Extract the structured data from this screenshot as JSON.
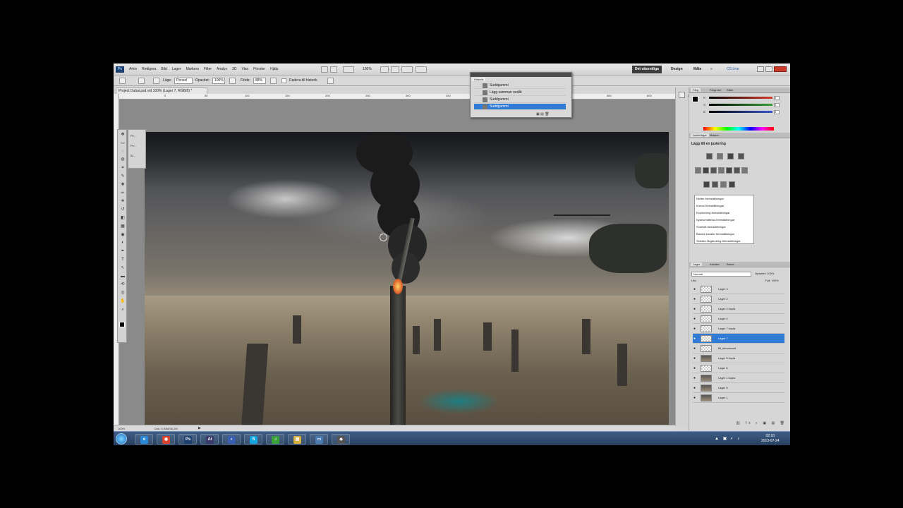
{
  "app": {
    "logo": "Ps",
    "menu": [
      "Arkiv",
      "Redigera",
      "Bild",
      "Lager",
      "Markera",
      "Filter",
      "Analys",
      "3D",
      "Visa",
      "Fönster",
      "Hjälp"
    ],
    "zoom": "100%",
    "workspaces": {
      "essentials": "Det väsentliga",
      "design": "Design",
      "more": "Måla",
      "chevron": "»",
      "cslive": "CS Live"
    }
  },
  "options_bar": {
    "mode_label": "Läge:",
    "mode_value": "Pensel",
    "opacity_label": "Opacitet:",
    "opacity_value": "100%",
    "flow_label": "Flöde:",
    "flow_value": "88%",
    "erase_label": "Radera till historik"
  },
  "document": {
    "tab_title": "Project Dubai.psd vid 100% (Lager 7, RGB/8) *",
    "ruler_numbers": [
      "0",
      "50",
      "100",
      "150",
      "200",
      "250",
      "300",
      "350",
      "400",
      "450",
      "500",
      "550",
      "600",
      "650",
      "700"
    ],
    "status_zoom": "100%",
    "status_doc": "Dok: 5,93M/36,2M"
  },
  "history": {
    "tab": "Historik",
    "rows": [
      {
        "label": "Suddgummi",
        "selected": false
      },
      {
        "label": "Lägg samman nedåt",
        "selected": false
      },
      {
        "label": "Suddgummi",
        "selected": false
      },
      {
        "label": "Suddgummi",
        "selected": true
      }
    ]
  },
  "tool_presets": [
    "Pe...",
    "Pe...",
    "Bi..."
  ],
  "color_panel": {
    "tabs": [
      "Färg",
      "Färgrutor",
      "Stilar"
    ],
    "sliders": [
      {
        "label": "R",
        "value": "0",
        "color": "#d43a2a"
      },
      {
        "label": "G",
        "value": "0",
        "color": "#3aa03a"
      },
      {
        "label": "B",
        "value": "0",
        "color": "#3a55c8"
      }
    ]
  },
  "adjustments": {
    "tabs": [
      "Justeringar",
      "Masker"
    ],
    "title": "Lägg till en justering",
    "presets": [
      "Nivåer-förinställningar",
      "Kurvor-förinställningar",
      "Exponering-förinställningar",
      "Nyans/mättnad-förinställningar",
      "Svartvitt-förinställningar",
      "Blanda kanaler-förinställningar",
      "Selektiv färgändring-förinställningar"
    ]
  },
  "layers": {
    "tabs": [
      "Lager",
      "Kanaler",
      "Banor"
    ],
    "mode": "Normal",
    "opacity_label": "Opacitet: 100%",
    "lock_label": "Lås:",
    "fill_label": "Fyll: 100%",
    "rows": [
      {
        "name": "Lager 3",
        "selected": false,
        "thumb": "empty"
      },
      {
        "name": "Lager 2",
        "selected": false,
        "thumb": "empty"
      },
      {
        "name": "Lager 4 kopia",
        "selected": false,
        "thumb": "empty"
      },
      {
        "name": "Lager 4",
        "selected": false,
        "thumb": "empty"
      },
      {
        "name": "Lager 7 kopia",
        "selected": false,
        "thumb": "empty"
      },
      {
        "name": "Lager 7",
        "selected": true,
        "thumb": "empty"
      },
      {
        "name": "fill_shuvesmid",
        "selected": false,
        "thumb": "empty"
      },
      {
        "name": "Lager 5 kopia",
        "selected": false,
        "thumb": "img"
      },
      {
        "name": "Lager 6",
        "selected": false,
        "thumb": "empty"
      },
      {
        "name": "Lager 1 kopia",
        "selected": false,
        "thumb": "img"
      },
      {
        "name": "Lager 5",
        "selected": false,
        "thumb": "img"
      },
      {
        "name": "Lager 1",
        "selected": false,
        "thumb": "img"
      }
    ]
  },
  "taskbar": {
    "apps": [
      {
        "name": "ie-icon",
        "glyph": "e",
        "color": "#2a8ad8"
      },
      {
        "name": "chrome-icon",
        "glyph": "◉",
        "color": "#d8462f"
      },
      {
        "name": "photoshop-icon",
        "glyph": "Ps",
        "color": "#1c3f6e"
      },
      {
        "name": "aftereffects-icon",
        "glyph": "Ai",
        "color": "#3a3a6a"
      },
      {
        "name": "firefox-icon",
        "glyph": "◐",
        "color": "#3a5fb0"
      },
      {
        "name": "skype-icon",
        "glyph": "S",
        "color": "#12a5e0"
      },
      {
        "name": "spotify-icon",
        "glyph": "♫",
        "color": "#3aa03a"
      },
      {
        "name": "explorer-icon",
        "glyph": "▤",
        "color": "#d8b040"
      },
      {
        "name": "window-icon",
        "glyph": "▭",
        "color": "#4a7ab0"
      },
      {
        "name": "app-icon",
        "glyph": "◆",
        "color": "#555"
      }
    ],
    "time": "02:10",
    "date": "2013-07-24",
    "tray": "▲ ▣ ◐ ♪"
  }
}
